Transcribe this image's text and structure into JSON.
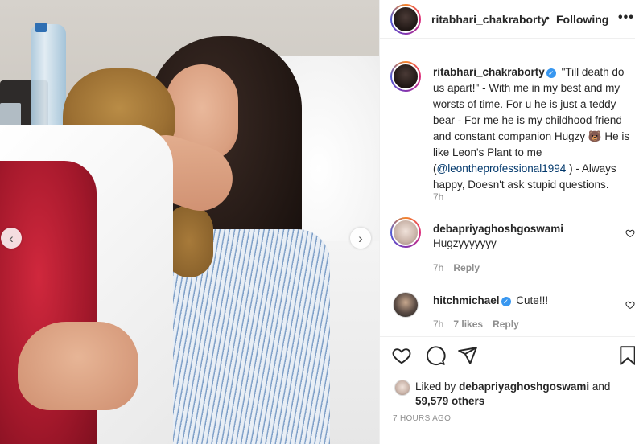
{
  "post": {
    "author": "ritabhari_chakraborty",
    "follow_state": "Following",
    "header_separator": "•",
    "more_label": "•••"
  },
  "caption": {
    "username": "ritabhari_chakraborty",
    "verified_mark": "✓",
    "text_part1": "\"Till death do us apart!\" - With me in my best and my worsts of time. For u he is just a teddy bear - For me he is my childhood friend and constant companion Hugzy 🐻 He is like Leon's Plant to me (",
    "mention": "@leontheprofessional1994",
    "text_part2": " ) - Always happy, Doesn't ask stupid questions.",
    "time": "7h"
  },
  "comments": [
    {
      "username": "debapriyaghoshgoswami",
      "text": "Hugzyyyyyyy",
      "time": "7h",
      "reply_label": "Reply"
    },
    {
      "username": "hitchmichael",
      "verified_mark": "✓",
      "text": "Cute!!!",
      "time": "7h",
      "likes": "7 likes",
      "reply_label": "Reply"
    }
  ],
  "carousel": {
    "prev_glyph": "‹",
    "next_glyph": "›"
  },
  "likes": {
    "prefix": "Liked by",
    "user": "debapriyaghoshgoswami",
    "conj": "and",
    "others": "59,579 others"
  },
  "timestamp": "7 HOURS AGO",
  "icons": [
    "heart-icon",
    "comment-icon",
    "share-icon",
    "bookmark-icon",
    "more-icon",
    "chevron-left-icon",
    "chevron-right-icon"
  ],
  "colors": {
    "text": "#262626",
    "muted": "#8e8e8e",
    "verified": "#3897f0",
    "mention": "#00376b"
  }
}
